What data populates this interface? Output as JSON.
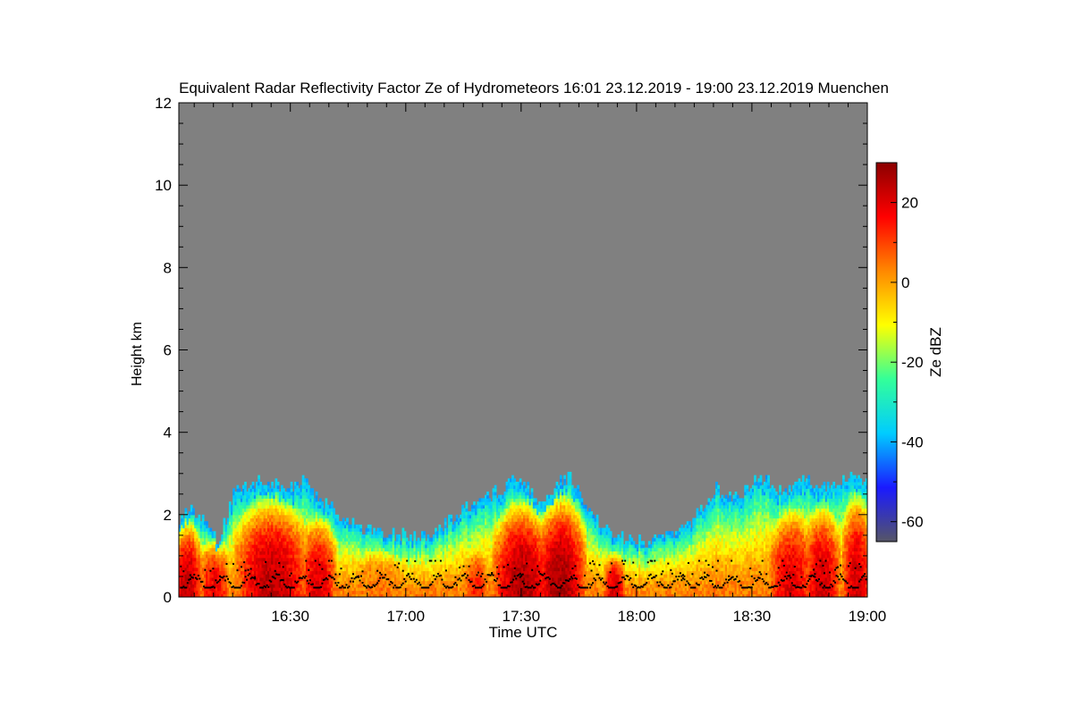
{
  "chart_data": {
    "type": "heatmap",
    "title": "Equivalent Radar Reflectivity Factor Ze of Hydrometeors   16:01 23.12.2019 - 19:00 23.12.2019 Muenchen",
    "xlabel": "Time UTC",
    "ylabel": "Height km",
    "x_range": [
      "16:01",
      "19:00"
    ],
    "xlim_minutes": [
      961,
      1140
    ],
    "x_ticks": [
      {
        "label": "16:30",
        "minutes": 990
      },
      {
        "label": "17:00",
        "minutes": 1020
      },
      {
        "label": "17:30",
        "minutes": 1050
      },
      {
        "label": "18:00",
        "minutes": 1080
      },
      {
        "label": "18:30",
        "minutes": 1110
      },
      {
        "label": "19:00",
        "minutes": 1140
      }
    ],
    "ylim": [
      0,
      12
    ],
    "y_ticks": [
      0,
      2,
      4,
      6,
      8,
      10,
      12
    ],
    "background_color": "#808080",
    "colorbar": {
      "label": "Ze dBZ",
      "range": [
        -65,
        30
      ],
      "ticks": [
        20,
        0,
        -20,
        -40,
        -60
      ],
      "colors": [
        "#555566",
        "#1a1aff",
        "#00ccff",
        "#33ff99",
        "#ffff00",
        "#ff8800",
        "#ff0000",
        "#8b0000"
      ]
    },
    "echo_top_km": [
      {
        "t": 961,
        "top": 1.9
      },
      {
        "t": 964,
        "top": 2.2
      },
      {
        "t": 967,
        "top": 1.8
      },
      {
        "t": 971,
        "top": 1.3
      },
      {
        "t": 975,
        "top": 2.5
      },
      {
        "t": 980,
        "top": 2.8
      },
      {
        "t": 984,
        "top": 2.7
      },
      {
        "t": 990,
        "top": 2.6
      },
      {
        "t": 994,
        "top": 2.8
      },
      {
        "t": 998,
        "top": 2.3
      },
      {
        "t": 1004,
        "top": 1.8
      },
      {
        "t": 1010,
        "top": 1.6
      },
      {
        "t": 1016,
        "top": 1.5
      },
      {
        "t": 1022,
        "top": 1.4
      },
      {
        "t": 1028,
        "top": 1.6
      },
      {
        "t": 1034,
        "top": 2.0
      },
      {
        "t": 1040,
        "top": 2.3
      },
      {
        "t": 1046,
        "top": 2.7
      },
      {
        "t": 1050,
        "top": 2.8
      },
      {
        "t": 1054,
        "top": 2.3
      },
      {
        "t": 1058,
        "top": 2.6
      },
      {
        "t": 1062,
        "top": 2.9
      },
      {
        "t": 1066,
        "top": 2.3
      },
      {
        "t": 1071,
        "top": 1.6
      },
      {
        "t": 1076,
        "top": 1.4
      },
      {
        "t": 1082,
        "top": 1.3
      },
      {
        "t": 1088,
        "top": 1.4
      },
      {
        "t": 1094,
        "top": 1.7
      },
      {
        "t": 1100,
        "top": 2.6
      },
      {
        "t": 1106,
        "top": 2.4
      },
      {
        "t": 1112,
        "top": 2.9
      },
      {
        "t": 1118,
        "top": 2.5
      },
      {
        "t": 1124,
        "top": 2.8
      },
      {
        "t": 1130,
        "top": 2.6
      },
      {
        "t": 1136,
        "top": 3.0
      },
      {
        "t": 1140,
        "top": 2.7
      }
    ],
    "convective_cores": [
      {
        "t": 963,
        "width": 4,
        "top": 1.7,
        "peak_dbz": 24
      },
      {
        "t": 970,
        "width": 4,
        "top": 1.2,
        "peak_dbz": 18
      },
      {
        "t": 985,
        "width": 10,
        "top": 2.3,
        "peak_dbz": 24
      },
      {
        "t": 997,
        "width": 5,
        "top": 1.8,
        "peak_dbz": 20
      },
      {
        "t": 1013,
        "width": 6,
        "top": 0.9,
        "peak_dbz": 5
      },
      {
        "t": 1038,
        "width": 3,
        "top": 0.8,
        "peak_dbz": 14
      },
      {
        "t": 1050,
        "width": 8,
        "top": 2.2,
        "peak_dbz": 26
      },
      {
        "t": 1060,
        "width": 7,
        "top": 2.4,
        "peak_dbz": 27
      },
      {
        "t": 1074,
        "width": 3,
        "top": 0.8,
        "peak_dbz": 22
      },
      {
        "t": 1120,
        "width": 6,
        "top": 2.0,
        "peak_dbz": 20
      },
      {
        "t": 1128,
        "width": 5,
        "top": 2.1,
        "peak_dbz": 22
      },
      {
        "t": 1137,
        "width": 4,
        "top": 2.4,
        "peak_dbz": 22
      }
    ],
    "cloud_base_km_range": [
      0.25,
      0.7
    ],
    "legend": "none",
    "grid": false
  }
}
